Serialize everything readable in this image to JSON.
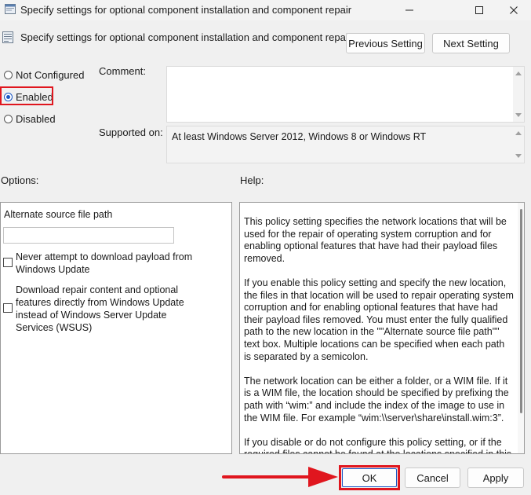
{
  "window": {
    "title": "Specify settings for optional component installation and component repair",
    "minimize_icon": "minimize-icon",
    "maximize_icon": "maximize-icon",
    "close_icon": "close-icon"
  },
  "header": {
    "title": "Specify settings for optional component installation and component repair",
    "previous_label": "Previous Setting",
    "next_label": "Next Setting"
  },
  "state": {
    "options": [
      {
        "label": "Not Configured",
        "checked": false
      },
      {
        "label": "Enabled",
        "checked": true
      },
      {
        "label": "Disabled",
        "checked": false
      }
    ]
  },
  "comment": {
    "label": "Comment:",
    "value": ""
  },
  "supported": {
    "label": "Supported on:",
    "value": "At least Windows Server 2012, Windows 8 or Windows RT"
  },
  "options_panel": {
    "label": "Options:",
    "path_label": "Alternate source file path",
    "path_value": "",
    "checkbox1": {
      "label": "Never attempt to download payload from Windows Update",
      "checked": false
    },
    "checkbox2": {
      "label": "Download repair content and optional features directly from Windows Update instead of Windows Server Update Services (WSUS)",
      "checked": false
    }
  },
  "help_panel": {
    "label": "Help:",
    "paragraphs": [
      "This policy setting specifies the network locations that will be used for the repair of operating system corruption and for enabling optional features that have had their payload files removed.",
      "If you enable this policy setting and specify the new location, the files in that location will be used to repair operating system corruption and for enabling optional features that have had their payload files removed. You must enter the fully qualified path to the new location in the \"\"Alternate source file path\"\" text box. Multiple locations can be specified when each path is separated by a semicolon.",
      "The network location can be either a folder, or a WIM file. If it is a WIM file, the location should be specified by prefixing the path with “wim:” and include the index of the image to use in the WIM file. For example “wim:\\\\server\\share\\install.wim:3”.",
      "If you disable or do not configure this policy setting, or if the required files cannot be found at the locations specified in this policy setting, the files will be downloaded from Windows Update, if that is allowed by the policy settings for the computer."
    ]
  },
  "footer": {
    "ok_label": "OK",
    "cancel_label": "Cancel",
    "apply_label": "Apply"
  },
  "colors": {
    "highlight": "#e0161e",
    "radio_accent": "#1a56c4"
  }
}
